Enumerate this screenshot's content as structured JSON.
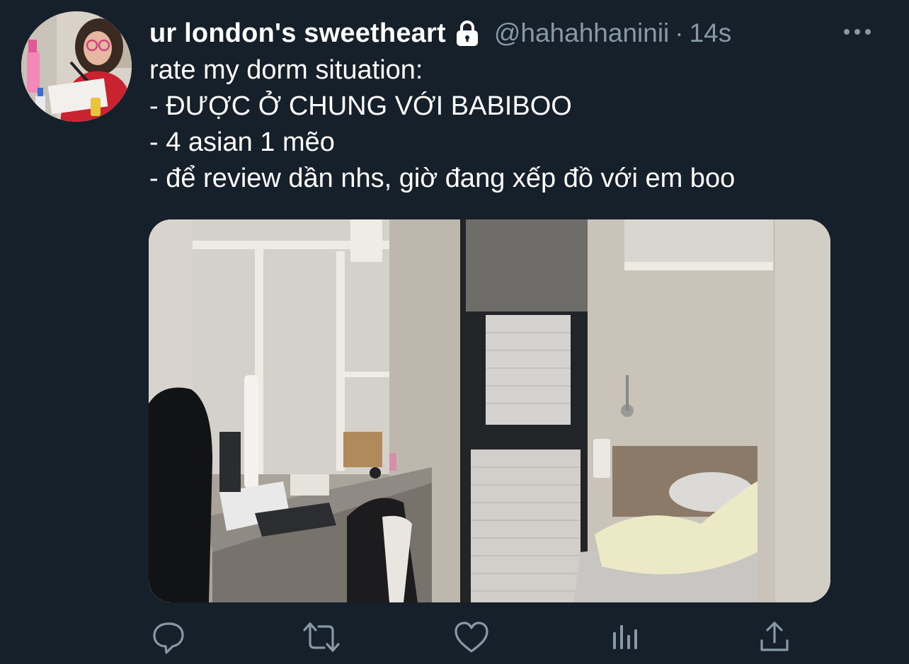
{
  "tweet": {
    "display_name": "ur london's sweetheart",
    "handle": "@hahahhaninii",
    "separator": "·",
    "time": "14s",
    "protected": true,
    "body_lines": [
      "rate my dorm situation:",
      "- ĐƯỢC Ở CHUNG VỚI BABIBOO",
      "- 4 asian 1 mẽo",
      "- để review dần nhs, giờ đang xếp đồ với em boo"
    ],
    "media": {
      "type": "photo",
      "subject": "dorm-room"
    }
  },
  "actions": [
    {
      "name": "reply",
      "icon": "reply-icon"
    },
    {
      "name": "retweet",
      "icon": "retweet-icon"
    },
    {
      "name": "like",
      "icon": "like-icon"
    },
    {
      "name": "analytics",
      "icon": "analytics-icon"
    },
    {
      "name": "share",
      "icon": "share-icon"
    }
  ],
  "colors": {
    "background": "#15202b",
    "secondary_text": "#8899a6",
    "icon": "#8899a6",
    "primary_text": "#ffffff"
  }
}
